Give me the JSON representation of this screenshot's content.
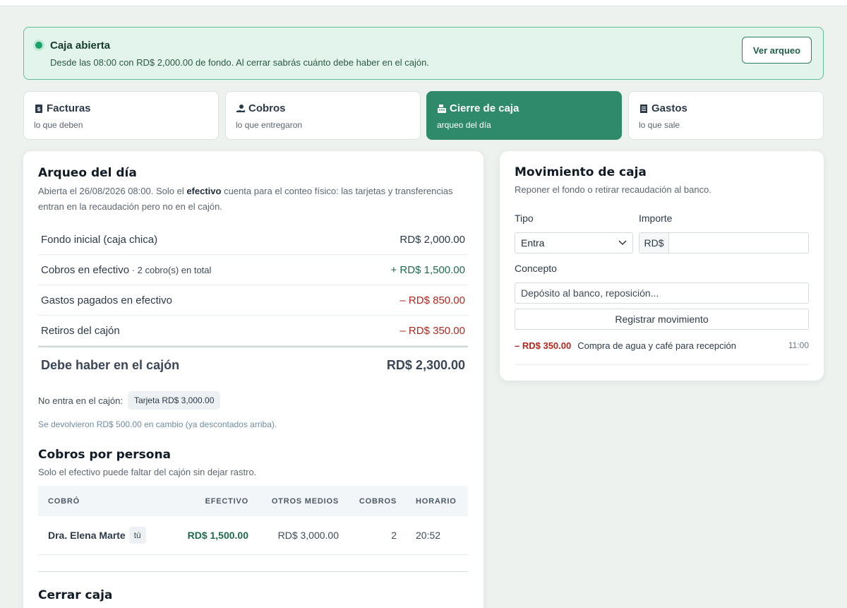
{
  "banner": {
    "title": "Caja abierta",
    "description": "Desde las 08:00 con RD$ 2,000.00 de fondo. Al cerrar sabrás cuánto debe haber en el cajón.",
    "button": "Ver arqueo"
  },
  "tabs": [
    {
      "label": "Facturas",
      "sub": "lo que deben",
      "icon": "invoice-icon"
    },
    {
      "label": "Cobros",
      "sub": "lo que entregaron",
      "icon": "hand-coin-icon"
    },
    {
      "label": "Cierre de caja",
      "sub": "arqueo del día",
      "icon": "cash-register-icon",
      "active": true
    },
    {
      "label": "Gastos",
      "sub": "lo que sale",
      "icon": "receipt-icon"
    }
  ],
  "arqueo": {
    "title": "Arqueo del día",
    "desc_pre": "Abierta el 26/08/2026 08:00. Solo el ",
    "desc_bold": "efectivo",
    "desc_post": " cuenta para el conteo físico: las tarjetas y transferencias entran en la recaudación pero no en el cajón.",
    "rows": [
      {
        "label": "Fondo inicial (caja chica)",
        "extra": "",
        "value": "RD$ 2,000.00",
        "kind": "neutral"
      },
      {
        "label": "Cobros en efectivo",
        "extra": " · 2 cobro(s) en total",
        "value": "+ RD$ 1,500.00",
        "kind": "pos"
      },
      {
        "label": "Gastos pagados en efectivo",
        "extra": "",
        "value": "– RD$ 850.00",
        "kind": "neg"
      },
      {
        "label": "Retiros del cajón",
        "extra": "",
        "value": "– RD$ 350.00",
        "kind": "neg"
      }
    ],
    "total_label": "Debe haber en el cajón",
    "total_value": "RD$ 2,300.00",
    "no_entra_label": "No entra en el cajón:",
    "no_entra_chip": "Tarjeta RD$ 3,000.00",
    "devuelto": "Se devolvieron RD$ 500.00 en cambio (ya descontados arriba)."
  },
  "cobros_persona": {
    "title": "Cobros por persona",
    "desc": "Solo el efectivo puede faltar del cajón sin dejar rastro.",
    "headers": [
      "COBRÓ",
      "EFECTIVO",
      "OTROS MEDIOS",
      "COBROS",
      "HORARIO"
    ],
    "rows": [
      {
        "name": "Dra. Elena Marte",
        "tag": "tú",
        "efectivo": "RD$ 1,500.00",
        "otros": "RD$ 3,000.00",
        "cobros": "2",
        "horario": "20:52"
      }
    ]
  },
  "cerrar": {
    "title": "Cerrar caja"
  },
  "movimiento": {
    "title": "Movimiento de caja",
    "desc": "Reponer el fondo o retirar recaudación al banco.",
    "tipo_label": "Tipo",
    "tipo_value": "Entra",
    "importe_label": "Importe",
    "importe_prefix": "RD$",
    "importe_value": "",
    "concepto_label": "Concepto",
    "concepto_placeholder": "Depósito al banco, reposición...",
    "button": "Registrar movimiento",
    "items": [
      {
        "amount": "– RD$ 350.00",
        "concept": "Compra de agua y café para recepción",
        "time": "11:00"
      }
    ]
  },
  "colors": {
    "accent": "#2f8a6c",
    "positive": "#1e6b4c",
    "negative": "#b3261e",
    "banner_bg": "#e3f4ec"
  }
}
